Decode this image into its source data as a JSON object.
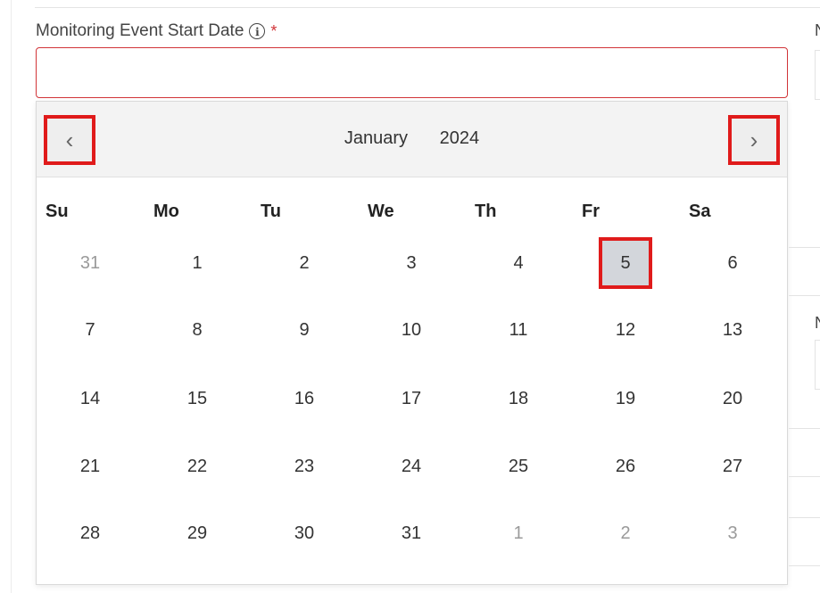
{
  "field": {
    "label": "Monitoring Event Start Date",
    "info_icon": "i",
    "required_mark": "*",
    "value": ""
  },
  "calendar": {
    "month": "January",
    "year": "2024",
    "prev_icon": "‹",
    "next_icon": "›",
    "weekdays": [
      "Su",
      "Mo",
      "Tu",
      "We",
      "Th",
      "Fr",
      "Sa"
    ],
    "weeks": [
      [
        "31",
        "1",
        "2",
        "3",
        "4",
        "5",
        "6"
      ],
      [
        "7",
        "8",
        "9",
        "10",
        "11",
        "12",
        "13"
      ],
      [
        "14",
        "15",
        "16",
        "17",
        "18",
        "19",
        "20"
      ],
      [
        "21",
        "22",
        "23",
        "24",
        "25",
        "26",
        "27"
      ],
      [
        "28",
        "29",
        "30",
        "31",
        "1",
        "2",
        "3"
      ]
    ],
    "outside_month": [
      [
        0,
        0
      ],
      [
        4,
        4
      ],
      [
        4,
        5
      ],
      [
        4,
        6
      ]
    ],
    "selected": [
      0,
      5
    ],
    "colors": {
      "highlight_border": "#e01b1b",
      "selected_bg": "#d3d6db",
      "error_border": "#d13438"
    }
  },
  "side": {
    "letter": "N"
  }
}
